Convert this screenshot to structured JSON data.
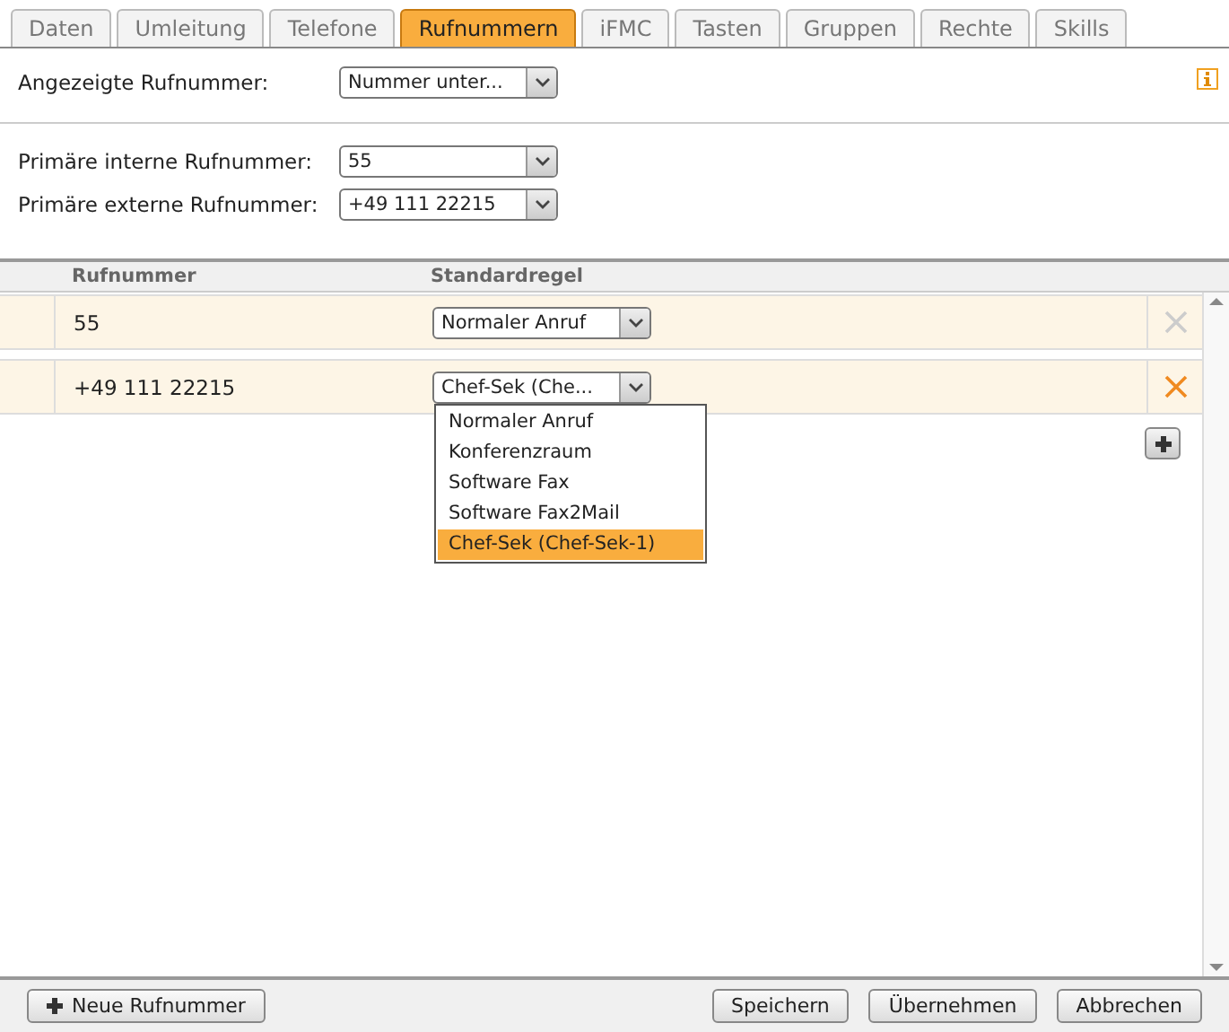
{
  "tabs": [
    {
      "label": "Daten",
      "selected": false
    },
    {
      "label": "Umleitung",
      "selected": false
    },
    {
      "label": "Telefone",
      "selected": false
    },
    {
      "label": "Rufnummern",
      "selected": true
    },
    {
      "label": "iFMC",
      "selected": false
    },
    {
      "label": "Tasten",
      "selected": false
    },
    {
      "label": "Gruppen",
      "selected": false
    },
    {
      "label": "Rechte",
      "selected": false
    },
    {
      "label": "Skills",
      "selected": false
    }
  ],
  "displayed_number": {
    "label": "Angezeigte Rufnummer:",
    "value": "Nummer unter..."
  },
  "primary_fields": [
    {
      "label": "Primäre interne Rufnummer:",
      "value": "55"
    },
    {
      "label": "Primäre externe Rufnummer:",
      "value": "+49 111 22215"
    }
  ],
  "table": {
    "columns": [
      "Rufnummer",
      "Standardregel"
    ],
    "rows": [
      {
        "number": "55",
        "rule": "Normaler Anruf",
        "delete_disabled": true
      },
      {
        "number": "+49 111 22215",
        "rule": "Chef-Sek (Che...",
        "delete_disabled": false,
        "options": [
          {
            "label": "Normaler Anruf",
            "selected": false
          },
          {
            "label": "Konferenzraum",
            "selected": false
          },
          {
            "label": "Software Fax",
            "selected": false
          },
          {
            "label": "Software Fax2Mail",
            "selected": false
          },
          {
            "label": "Chef-Sek (Chef-Sek-1)",
            "selected": true
          }
        ]
      }
    ]
  },
  "footer": {
    "new_button": "Neue Rufnummer",
    "buttons": [
      "Speichern",
      "Übernehmen",
      "Abbrechen"
    ]
  }
}
